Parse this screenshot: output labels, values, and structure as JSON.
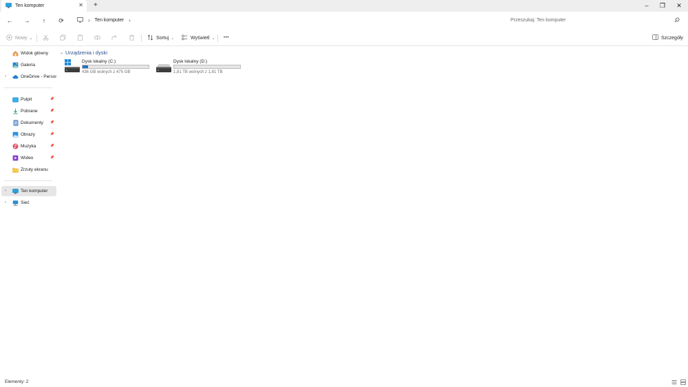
{
  "window": {
    "tab_title": "Ten komputer",
    "tab_close": "✕",
    "new_tab": "+",
    "minimize": "–",
    "restore": "❐",
    "close": "✕"
  },
  "nav": {
    "back": "←",
    "forward": "→",
    "up": "↑",
    "refresh": "⟳",
    "breadcrumb": [
      "Ten komputer"
    ],
    "search_placeholder": "Przeszukaj: Ten komputer"
  },
  "commands": {
    "new_label": "Nowy",
    "sort_label": "Sortuj",
    "view_label": "Wyświetl",
    "more_label": "•••",
    "details_label": "Szczegóły"
  },
  "sidebar": {
    "quick": [
      {
        "label": "Widok główny",
        "icon": "home-icon"
      },
      {
        "label": "Galeria",
        "icon": "gallery-icon"
      },
      {
        "label": "OneDrive - Persona",
        "icon": "cloud-icon",
        "expandable": true
      }
    ],
    "pinned": [
      {
        "label": "Pulpit",
        "icon": "desktop-icon",
        "pinned": true
      },
      {
        "label": "Pobrane",
        "icon": "download-icon",
        "pinned": true
      },
      {
        "label": "Dokumenty",
        "icon": "documents-icon",
        "pinned": true
      },
      {
        "label": "Obrazy",
        "icon": "pictures-icon",
        "pinned": true
      },
      {
        "label": "Muzyka",
        "icon": "music-icon",
        "pinned": true
      },
      {
        "label": "Wideo",
        "icon": "video-icon",
        "pinned": true
      },
      {
        "label": "Zrzuty ekranu",
        "icon": "folder-icon",
        "pinned": false
      }
    ],
    "locations": [
      {
        "label": "Ten komputer",
        "icon": "computer-icon",
        "selected": true
      },
      {
        "label": "Sieć",
        "icon": "network-icon",
        "selected": false
      }
    ]
  },
  "main": {
    "group_title": "Urządzenia i dyski",
    "drives": [
      {
        "name": "Dysk lokalny (C:)",
        "free_text": "436 GB wolnych z 475 GB",
        "used_fraction": 0.08,
        "icon": "windows-drive-icon"
      },
      {
        "name": "Dysk lokalny (D:)",
        "free_text": "1,81 TB wolnych z 1,81 TB",
        "used_fraction": 0.0,
        "icon": "hard-drive-icon"
      }
    ]
  },
  "status": {
    "items_text": "Elementy: 2"
  },
  "colors": {
    "accent": "#2a6fc9",
    "group_title": "#2a4e8e",
    "selected_bg": "#e6e6e6"
  }
}
